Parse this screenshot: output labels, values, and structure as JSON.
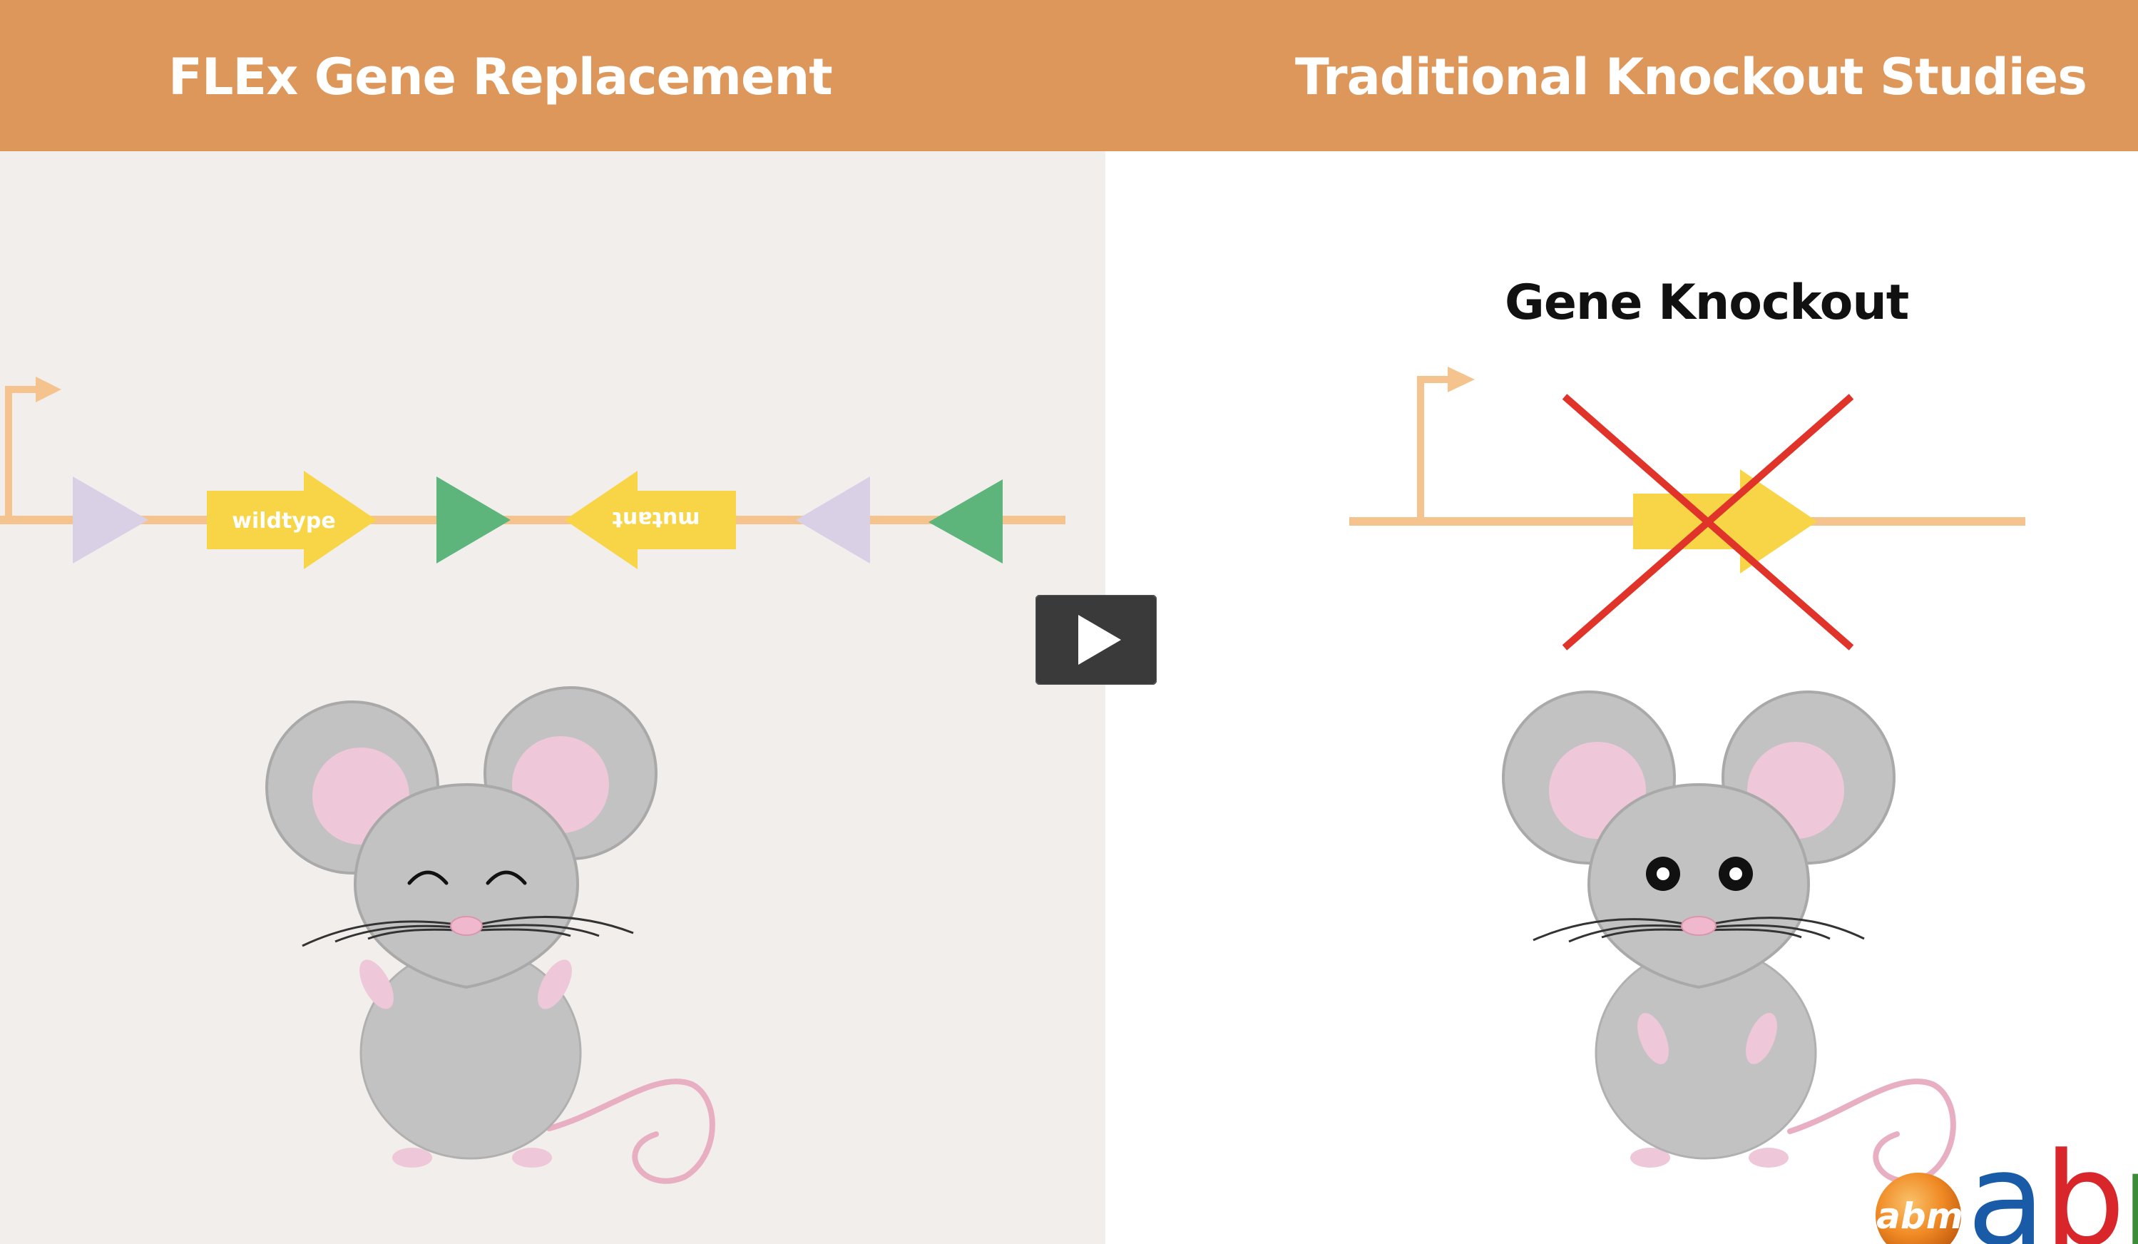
{
  "header": {
    "left_title": "FLEx Gene Replacement",
    "right_title": "Traditional Knockout Studies"
  },
  "left_panel": {
    "construct": {
      "wildtype_label": "wildtype",
      "mutant_label": "mutant"
    },
    "mouse_expression": "happy"
  },
  "right_panel": {
    "title": "Gene Knockout",
    "mouse_expression": "surprised"
  },
  "logo": {
    "badge_text": "abm",
    "wordmark": "abm"
  },
  "player": {
    "play_icon": "play-icon"
  },
  "colors": {
    "header_orange": "#DE975A",
    "left_bg": "#F2EEEC",
    "right_bg": "#FFFFFF",
    "dna_line": "#F5C48E",
    "gene_yellow": "#F7D547",
    "loxp_lavender": "#D9D0E6",
    "lox_green": "#5DB57C",
    "cross_red": "#E0332A",
    "mouse_gray": "#C2C2C2",
    "mouse_outline": "#A9A9A9",
    "ear_pink": "#EEC8D8",
    "tail_pink": "#E8AFC3",
    "play_bg": "#3A3A3A"
  }
}
